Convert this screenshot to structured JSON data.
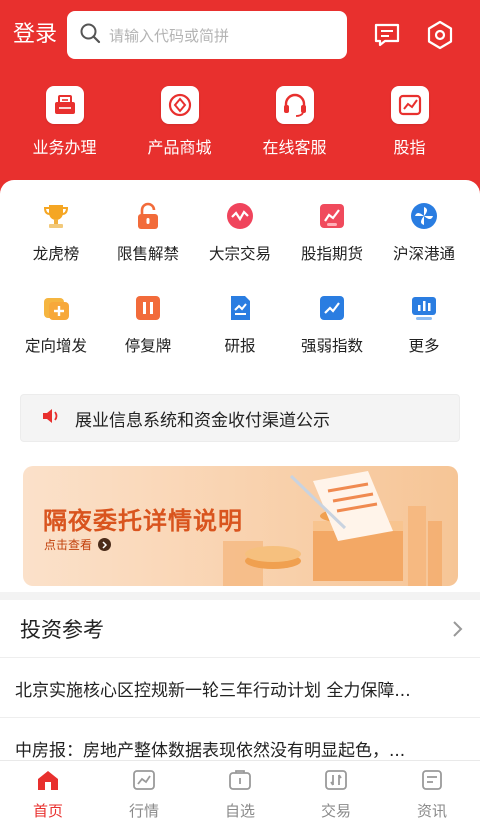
{
  "header": {
    "login_label": "登录",
    "search_placeholder": "请输入代码或简拼"
  },
  "top_nav": [
    {
      "label": "业务办理",
      "icon": "briefcase-icon"
    },
    {
      "label": "产品商城",
      "icon": "product-store-icon"
    },
    {
      "label": "在线客服",
      "icon": "headset-icon"
    },
    {
      "label": "股指",
      "icon": "stock-index-icon"
    }
  ],
  "grid_row1": [
    {
      "label": "龙虎榜",
      "icon": "trophy-icon"
    },
    {
      "label": "限售解禁",
      "icon": "unlock-icon"
    },
    {
      "label": "大宗交易",
      "icon": "block-trade-icon"
    },
    {
      "label": "股指期货",
      "icon": "index-futures-icon"
    },
    {
      "label": "沪深港通",
      "icon": "pinwheel-icon"
    }
  ],
  "grid_row2": [
    {
      "label": "定向增发",
      "icon": "private-placement-icon"
    },
    {
      "label": "停复牌",
      "icon": "suspension-icon"
    },
    {
      "label": "研报",
      "icon": "report-icon"
    },
    {
      "label": "强弱指数",
      "icon": "strength-index-icon"
    },
    {
      "label": "更多",
      "icon": "more-icon"
    }
  ],
  "notice": {
    "text": "展业信息系统和资金收付渠道公示"
  },
  "banner": {
    "title": "隔夜委托详情说明",
    "subtitle": "点击查看"
  },
  "section": {
    "title": "投资参考"
  },
  "news": [
    {
      "text": "北京实施核心区控规新一轮三年行动计划 全力保障..."
    },
    {
      "text": "中房报：房地产整体数据表现依然没有明显起色，..."
    }
  ],
  "tabs": [
    {
      "label": "首页",
      "active": true
    },
    {
      "label": "行情",
      "active": false
    },
    {
      "label": "自选",
      "active": false
    },
    {
      "label": "交易",
      "active": false
    },
    {
      "label": "资讯",
      "active": false
    }
  ],
  "colors": {
    "brand_red": "#e8302e",
    "banner_text": "#d9541e"
  }
}
